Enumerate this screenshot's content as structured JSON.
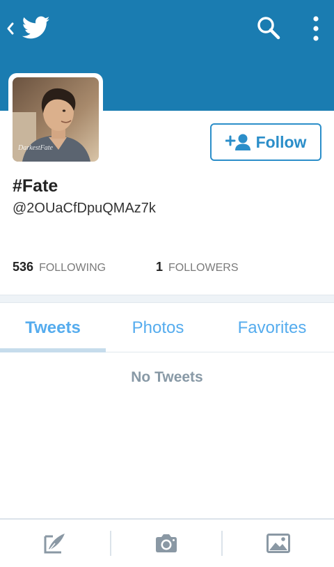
{
  "header": {
    "background": "#1a7cb1",
    "icons": {
      "back": "chevron-left-icon",
      "logo": "twitter-bird-icon",
      "search": "search-icon",
      "more": "vertical-dots-icon"
    }
  },
  "profile": {
    "display_name": "#Fate",
    "handle": "@2OUaCfDpuQMAz7k",
    "avatar_watermark": "DarkestFate"
  },
  "follow_button": {
    "label": "Follow",
    "color": "#2b8ec9"
  },
  "stats": {
    "following_count": "536",
    "following_label": "FOLLOWING",
    "followers_count": "1",
    "followers_label": "FOLLOWERS"
  },
  "tabs": [
    {
      "label": "Tweets",
      "active": true
    },
    {
      "label": "Photos",
      "active": false
    },
    {
      "label": "Favorites",
      "active": false
    }
  ],
  "empty_state": "No Tweets",
  "toolbar": {
    "icons": [
      "compose-tweet-icon",
      "camera-icon",
      "photo-icon"
    ]
  }
}
